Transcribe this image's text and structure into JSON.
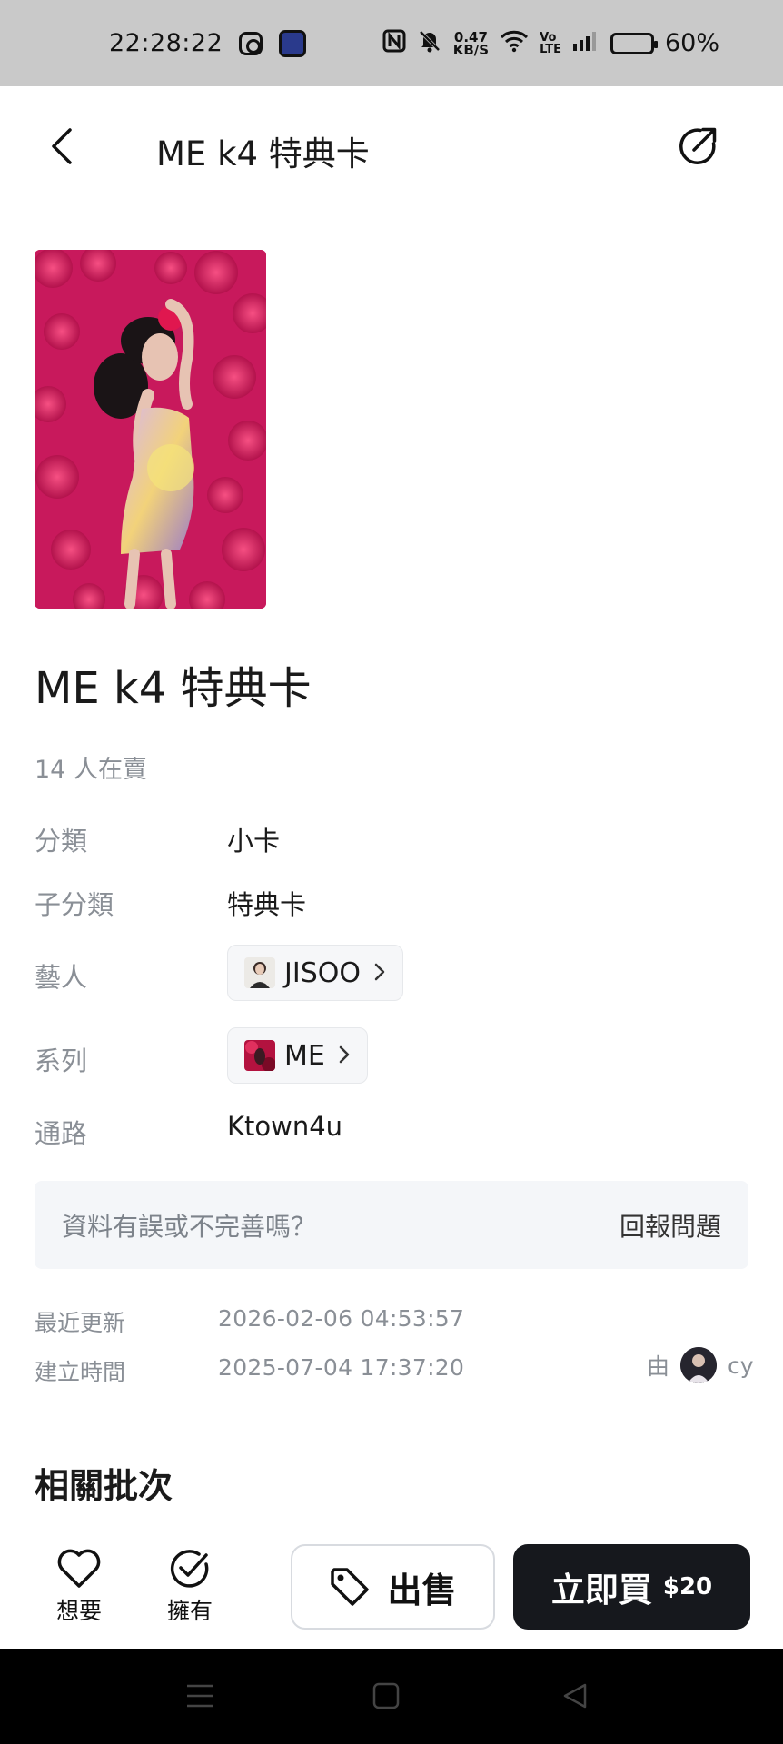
{
  "status_bar": {
    "time": "22:28:22",
    "net_speed_value": "0.47",
    "net_speed_unit": "KB/S",
    "volte_top": "Vo",
    "volte_bottom": "LTE",
    "battery_percent": "60%",
    "battery_level": 0.6,
    "icons": [
      "instagram-icon",
      "app-icon",
      "nfc-icon",
      "mute-icon",
      "wifi-icon",
      "signal-icon",
      "battery-icon"
    ]
  },
  "header": {
    "title": "ME k4 特典卡",
    "back_icon": "chevron-left-icon",
    "share_icon": "share-icon"
  },
  "product": {
    "title": "ME k4 特典卡",
    "sellers": "14 人在賣",
    "info": {
      "category_label": "分類",
      "category_value": "小卡",
      "subcategory_label": "子分類",
      "subcategory_value": "特典卡",
      "artist_label": "藝人",
      "artist_value": "JISOO",
      "series_label": "系列",
      "series_value": "ME",
      "channel_label": "通路",
      "channel_value": "Ktown4u"
    }
  },
  "report": {
    "question": "資料有誤或不完善嗎？",
    "link": "回報問題"
  },
  "meta": {
    "updated_label": "最近更新",
    "updated_value": "2026-02-06 04:53:57",
    "created_label": "建立時間",
    "created_value": "2025-07-04 17:37:20",
    "by_label": "由",
    "creator_name": "cy"
  },
  "related": {
    "title": "相關批次"
  },
  "actions": {
    "want_label": "想要",
    "own_label": "擁有",
    "sell_label": "出售",
    "buy_label": "立即買",
    "buy_price": "$20"
  },
  "colors": {
    "accent_dark": "#16181d",
    "muted_text": "#8a8f96",
    "card_bg": "#c8195c"
  }
}
